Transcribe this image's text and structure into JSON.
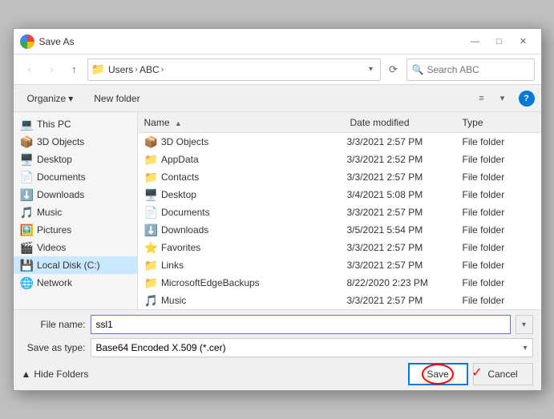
{
  "dialog": {
    "title": "Save As",
    "chrome_icon_alt": "chrome-icon"
  },
  "title_controls": {
    "minimize": "—",
    "maximize": "□",
    "close": "✕"
  },
  "nav": {
    "back": "‹",
    "forward": "›",
    "up": "↑"
  },
  "address": {
    "folder_icon": "📁",
    "breadcrumbs": [
      "Users",
      "ABC"
    ],
    "separator": "›",
    "dropdown_arrow": "▾",
    "refresh": "⟳"
  },
  "search": {
    "placeholder": "Search ABC",
    "icon": "🔍"
  },
  "second_toolbar": {
    "organize_label": "Organize",
    "organize_arrow": "▾",
    "new_folder_label": "New folder",
    "view_icon1": "≡",
    "view_icon2": "▾",
    "help": "?"
  },
  "left_panel": {
    "items": [
      {
        "icon": "💻",
        "label": "This PC",
        "type": "pc"
      },
      {
        "icon": "📦",
        "label": "3D Objects",
        "type": "folder-blue"
      },
      {
        "icon": "🖥️",
        "label": "Desktop",
        "type": "folder-blue"
      },
      {
        "icon": "📄",
        "label": "Documents",
        "type": "folder-blue"
      },
      {
        "icon": "⬇️",
        "label": "Downloads",
        "type": "folder-blue"
      },
      {
        "icon": "🎵",
        "label": "Music",
        "type": "folder-blue"
      },
      {
        "icon": "🖼️",
        "label": "Pictures",
        "type": "folder-blue"
      },
      {
        "icon": "🎬",
        "label": "Videos",
        "type": "folder-blue"
      },
      {
        "icon": "💾",
        "label": "Local Disk (C:)",
        "type": "drive"
      },
      {
        "icon": "🌐",
        "label": "Network",
        "type": "network"
      }
    ]
  },
  "file_list": {
    "columns": {
      "name": "Name",
      "date": "Date modified",
      "type": "Type",
      "sort_arrow": "▲"
    },
    "files": [
      {
        "icon": "📦",
        "name": "3D Objects",
        "date": "3/3/2021 2:57 PM",
        "type": "File folder"
      },
      {
        "icon": "📁",
        "name": "AppData",
        "date": "3/3/2021 2:52 PM",
        "type": "File folder"
      },
      {
        "icon": "📁",
        "name": "Contacts",
        "date": "3/3/2021 2:57 PM",
        "type": "File folder"
      },
      {
        "icon": "🖥️",
        "name": "Desktop",
        "date": "3/4/2021 5:08 PM",
        "type": "File folder"
      },
      {
        "icon": "📄",
        "name": "Documents",
        "date": "3/3/2021 2:57 PM",
        "type": "File folder"
      },
      {
        "icon": "⬇️",
        "name": "Downloads",
        "date": "3/5/2021 5:54 PM",
        "type": "File folder"
      },
      {
        "icon": "⭐",
        "name": "Favorites",
        "date": "3/3/2021 2:57 PM",
        "type": "File folder"
      },
      {
        "icon": "📁",
        "name": "Links",
        "date": "3/3/2021 2:57 PM",
        "type": "File folder"
      },
      {
        "icon": "📁",
        "name": "MicrosoftEdgeBackups",
        "date": "8/22/2020 2:23 PM",
        "type": "File folder"
      },
      {
        "icon": "🎵",
        "name": "Music",
        "date": "3/3/2021 2:57 PM",
        "type": "File folder"
      }
    ]
  },
  "bottom": {
    "file_name_label": "File name:",
    "file_name_value": "ssl1",
    "save_type_label": "Save as type:",
    "save_type_value": "Base64 Encoded X.509 (*.cer)",
    "hide_folders_label": "Hide Folders",
    "hide_arrow": "▲",
    "save_label": "Save",
    "cancel_label": "Cancel"
  }
}
